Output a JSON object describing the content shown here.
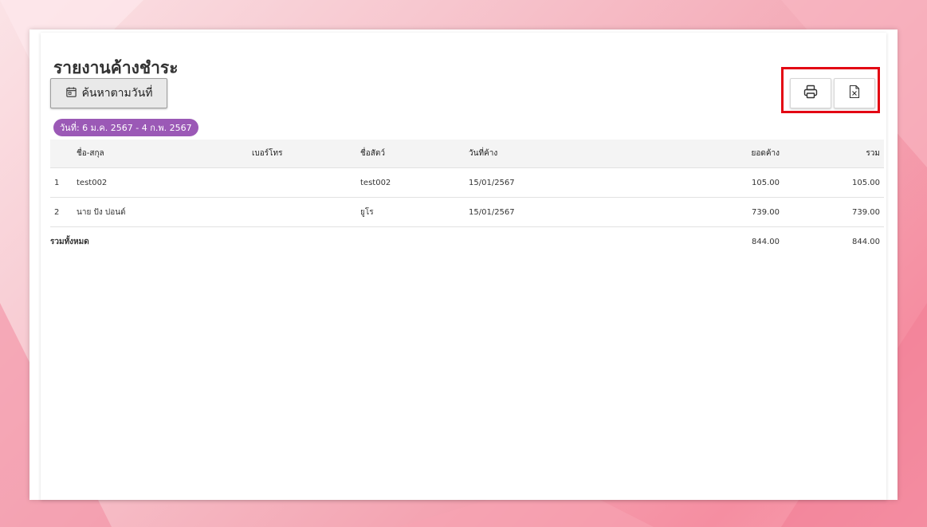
{
  "page": {
    "title": "รายงานค้างชำระ",
    "date_search_label": "ค้นหาตามวันที่",
    "date_badge": "วันที่: 6 ม.ค. 2567 - 4 ก.พ. 2567"
  },
  "toolbar": {
    "print_icon": "printer-icon",
    "excel_icon": "excel-file-icon"
  },
  "table": {
    "headers": [
      "ชื่อ-สกุล",
      "เบอร์โทร",
      "ชื่อสัตว์",
      "วันที่ค้าง",
      "ยอดค้าง",
      "รวม"
    ],
    "rows": [
      {
        "index": "1",
        "name": "test002",
        "phone": "",
        "pet": "test002",
        "date": "15/01/2567",
        "owed": "105.00",
        "total": "105.00"
      },
      {
        "index": "2",
        "name": "นาย ปัง ปอนด์",
        "phone": "",
        "pet": "ยูโร",
        "date": "15/01/2567",
        "owed": "739.00",
        "total": "739.00"
      }
    ],
    "footer": {
      "label": "รวมทั้งหมด",
      "owed": "844.00",
      "total": "844.00"
    }
  },
  "colors": {
    "accent_badge": "#9b59b6",
    "highlight": "#e30613",
    "background_pink": "#f58ea1"
  }
}
